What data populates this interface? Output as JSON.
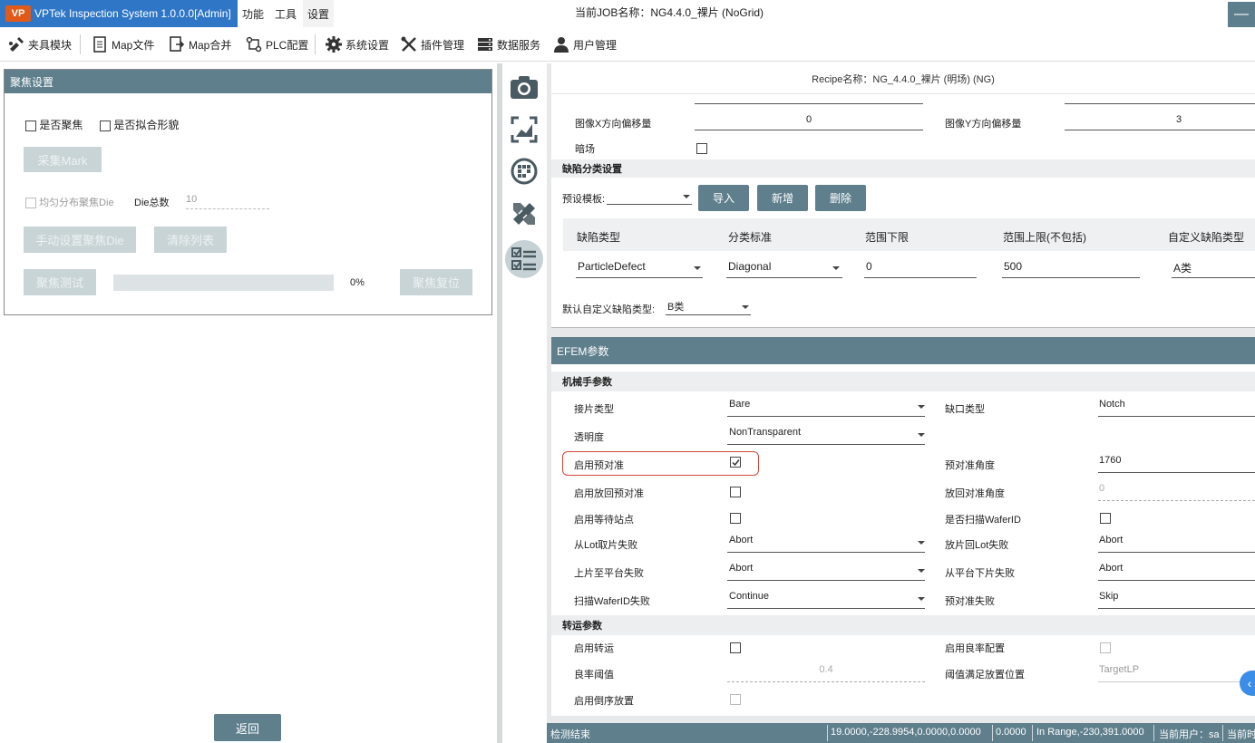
{
  "app": {
    "logo": "VP",
    "title": "VPTek Inspection System 1.0.0.0[Admin]"
  },
  "menu": [
    "功能",
    "工具",
    "设置"
  ],
  "job_name": "当前JOB名称：NG4.4.0_裸片 (NoGrid)",
  "window_button": "—",
  "toolbar": [
    {
      "label": "夹具模块",
      "icon": "fixture-icon"
    },
    {
      "label": "Map文件",
      "icon": "map-file-icon"
    },
    {
      "label": "Map合并",
      "icon": "map-merge-icon"
    },
    {
      "label": "PLC配置",
      "icon": "plc-icon"
    },
    {
      "label": "系统设置",
      "icon": "gear-icon"
    },
    {
      "label": "插件管理",
      "icon": "tools-icon"
    },
    {
      "label": "数据服务",
      "icon": "data-service-icon"
    },
    {
      "label": "用户管理",
      "icon": "user-icon"
    }
  ],
  "focus": {
    "title": "聚焦设置",
    "enable_focus": "是否聚焦",
    "fit_shape": "是否拟合形貌",
    "collect_mark": "采集Mark",
    "uniform_die": "均匀分布聚焦Die",
    "die_total_label": "Die总数",
    "die_total_value": "10",
    "manual_die": "手动设置聚焦Die",
    "clear_list": "清除列表",
    "focus_test": "聚焦测试",
    "progress_text": "0%",
    "progress": 0,
    "focus_reset": "聚焦复位",
    "back": "返回"
  },
  "recipe_name": "Recipe名称：NG_4.4.0_裸片 (明场) (NG)",
  "image_offsets": {
    "x_label": "图像X方向偏移量",
    "x_value": "0",
    "y_label": "图像Y方向偏移量",
    "y_value": "3",
    "dark_label": "暗场"
  },
  "defect": {
    "title": "缺陷分类设置",
    "template_label": "预设模板:",
    "template_value": "",
    "import": "导入",
    "add": "新增",
    "delete": "删除",
    "columns": [
      "缺陷类型",
      "分类标准",
      "范围下限",
      "范围上限(不包括)",
      "自定义缺陷类型"
    ],
    "row": [
      "ParticleDefect",
      "Diagonal",
      "0",
      "500",
      "A类"
    ],
    "default_label": "默认自定义缺陷类型:",
    "default_value": "B类"
  },
  "efem": {
    "title": "EFEM参数",
    "robot_title": "机械手参数",
    "transfer_title": "转运参数",
    "labels": {
      "load_type": "接片类型",
      "notch_type": "缺口类型",
      "transparency": "透明度",
      "enable_prealign": "启用预对准",
      "prealign_angle": "预对准角度",
      "enable_return_prealign": "启用放回预对准",
      "return_angle": "放回对准角度",
      "enable_wait": "启用等待站点",
      "scan_waferid": "是否扫描WaferID",
      "lot_pick_fail": "从Lot取片失败",
      "lot_place_fail": "放片回Lot失败",
      "stage_load_fail": "上片至平台失败",
      "stage_unload_fail": "从平台下片失败",
      "scan_fail": "扫描WaferID失败",
      "prealign_fail": "预对准失败",
      "enable_transfer": "启用转运",
      "enable_yield": "启用良率配置",
      "yield_threshold": "良率阈值",
      "threshold_position": "阈值满足放置位置",
      "enable_reverse": "启用倒序放置"
    },
    "values": {
      "load_type": "Bare",
      "notch_type": "Notch",
      "transparency": "NonTransparent",
      "prealign_angle": "1760",
      "return_angle": "0",
      "lot_pick_fail": "Abort",
      "lot_place_fail": "Abort",
      "stage_load_fail": "Abort",
      "stage_unload_fail": "Abort",
      "scan_fail": "Continue",
      "prealign_fail": "Skip",
      "yield_threshold": "0.4",
      "threshold_position": "TargetLP"
    }
  },
  "status": {
    "left": "检测结束",
    "coords": "19.0000,-228.9954,0.0000,0.0000",
    "value": "0.0000",
    "range": "In Range,-230,391.0000",
    "user": "当前用户：sa",
    "current": "当前时"
  },
  "collapse_icon": "‹",
  "accent_color": "#5f7f8d",
  "highlight_color": "#d0473a"
}
